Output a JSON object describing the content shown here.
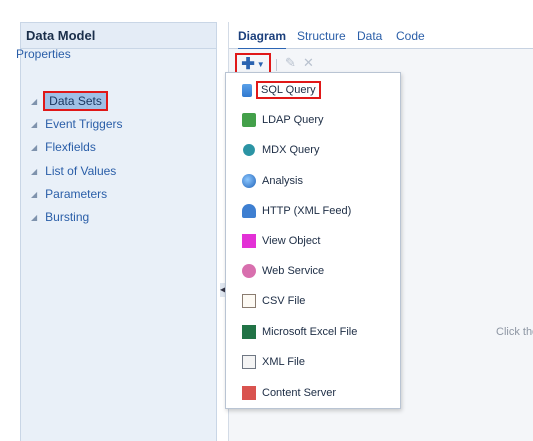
{
  "left_panel": {
    "title": "Data Model",
    "properties_label": "Properties",
    "items": [
      {
        "label": "Data Sets",
        "selected": true
      },
      {
        "label": "Event Triggers"
      },
      {
        "label": "Flexfields"
      },
      {
        "label": "List of Values"
      },
      {
        "label": "Parameters"
      },
      {
        "label": "Bursting"
      }
    ]
  },
  "tabs": [
    {
      "label": "Diagram",
      "active": true
    },
    {
      "label": "Structure"
    },
    {
      "label": "Data"
    },
    {
      "label": "Code"
    }
  ],
  "toolbar": {
    "add_icon": "plus-icon",
    "edit_icon": "pencil-icon",
    "delete_icon": "x-icon"
  },
  "menu": {
    "items": [
      {
        "label": "SQL Query",
        "icon": "database-icon"
      },
      {
        "label": "LDAP Query",
        "icon": "ldap-icon"
      },
      {
        "label": "MDX Query",
        "icon": "cube-icon"
      },
      {
        "label": "Analysis",
        "icon": "globe-icon"
      },
      {
        "label": "HTTP (XML Feed)",
        "icon": "http-icon"
      },
      {
        "label": "View Object",
        "icon": "view-object-icon"
      },
      {
        "label": "Web Service",
        "icon": "web-service-icon"
      },
      {
        "label": "CSV File",
        "icon": "csv-file-icon"
      },
      {
        "label": "Microsoft Excel File",
        "icon": "excel-file-icon"
      },
      {
        "label": "XML File",
        "icon": "xml-file-icon"
      },
      {
        "label": "Content Server",
        "icon": "content-server-icon"
      }
    ]
  },
  "canvas_hint": "Click the"
}
